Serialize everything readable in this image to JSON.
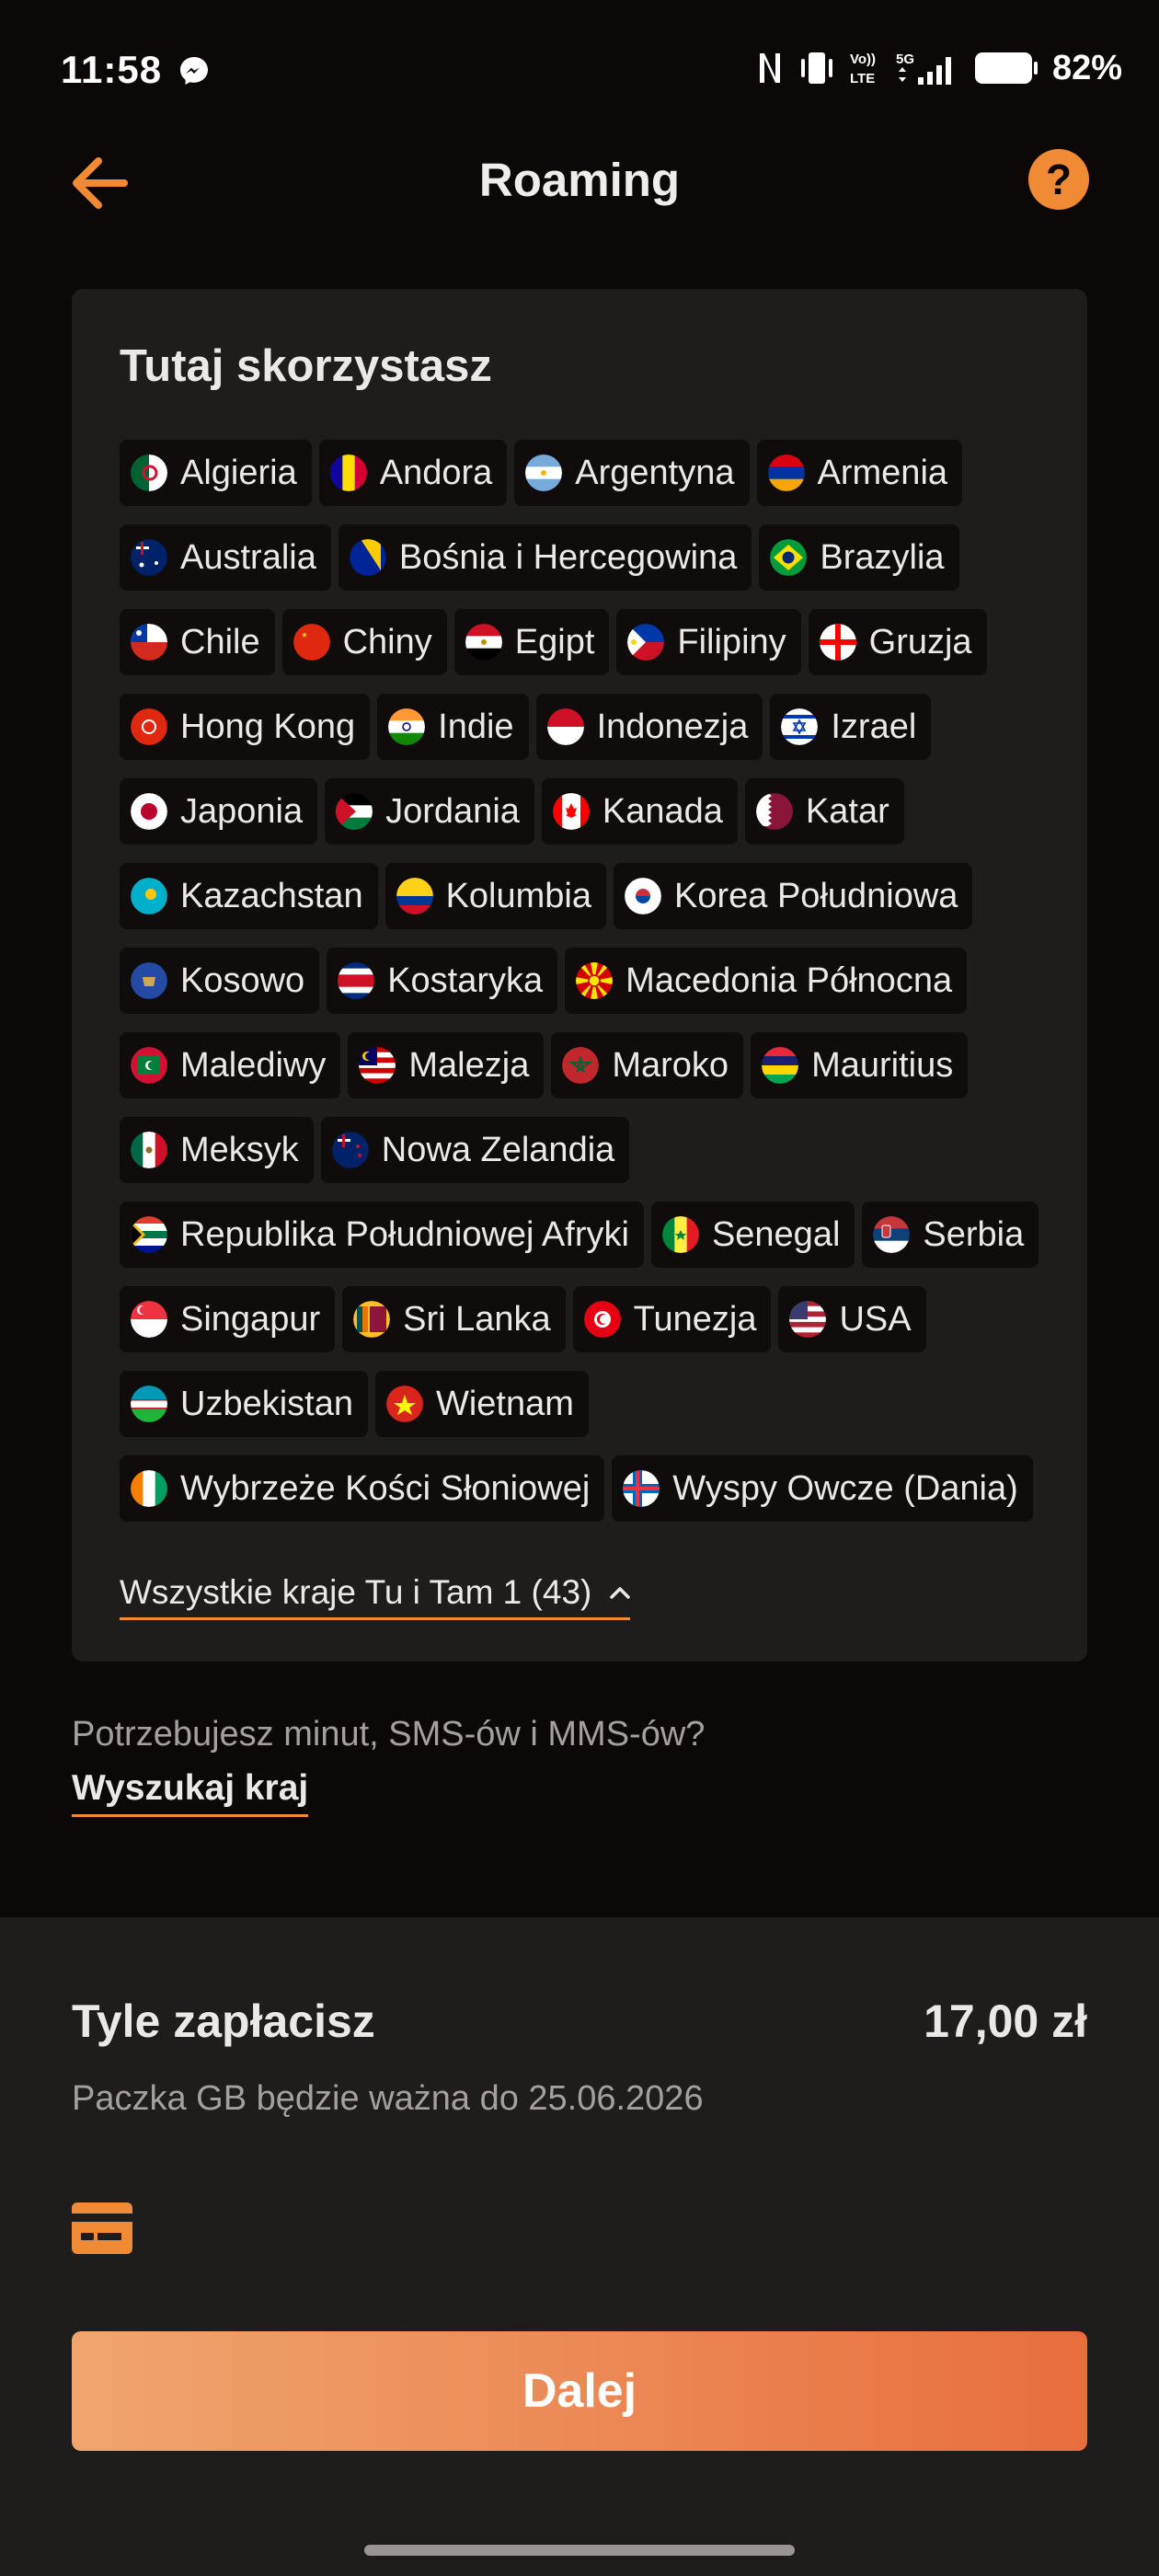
{
  "status_bar": {
    "time": "11:58",
    "network": "5G",
    "lte": "LTE",
    "volte": "Vo))",
    "battery": "82%"
  },
  "header": {
    "title": "Roaming"
  },
  "countries_card": {
    "title": "Tutaj skorzystasz",
    "countries": [
      {
        "name": "Algieria",
        "flag": "algeria"
      },
      {
        "name": "Andora",
        "flag": "andorra"
      },
      {
        "name": "Argentyna",
        "flag": "argentina"
      },
      {
        "name": "Armenia",
        "flag": "armenia"
      },
      {
        "name": "Australia",
        "flag": "australia"
      },
      {
        "name": "Bośnia i Hercegowina",
        "flag": "bosnia"
      },
      {
        "name": "Brazylia",
        "flag": "brazil"
      },
      {
        "name": "Chile",
        "flag": "chile"
      },
      {
        "name": "Chiny",
        "flag": "china"
      },
      {
        "name": "Egipt",
        "flag": "egypt"
      },
      {
        "name": "Filipiny",
        "flag": "philippines"
      },
      {
        "name": "Gruzja",
        "flag": "georgia"
      },
      {
        "name": "Hong Kong",
        "flag": "hongkong"
      },
      {
        "name": "Indie",
        "flag": "india"
      },
      {
        "name": "Indonezja",
        "flag": "indonesia"
      },
      {
        "name": "Izrael",
        "flag": "israel"
      },
      {
        "name": "Japonia",
        "flag": "japan"
      },
      {
        "name": "Jordania",
        "flag": "jordan"
      },
      {
        "name": "Kanada",
        "flag": "canada"
      },
      {
        "name": "Katar",
        "flag": "qatar"
      },
      {
        "name": "Kazachstan",
        "flag": "kazakhstan"
      },
      {
        "name": "Kolumbia",
        "flag": "colombia"
      },
      {
        "name": "Korea Południowa",
        "flag": "southkorea"
      },
      {
        "name": "Kosowo",
        "flag": "kosovo"
      },
      {
        "name": "Kostaryka",
        "flag": "costarica"
      },
      {
        "name": "Macedonia Północna",
        "flag": "macedonia"
      },
      {
        "name": "Malediwy",
        "flag": "maldives"
      },
      {
        "name": "Malezja",
        "flag": "malaysia"
      },
      {
        "name": "Maroko",
        "flag": "morocco"
      },
      {
        "name": "Mauritius",
        "flag": "mauritius"
      },
      {
        "name": "Meksyk",
        "flag": "mexico"
      },
      {
        "name": "Nowa Zelandia",
        "flag": "newzealand"
      },
      {
        "name": "Republika Południowej Afryki",
        "flag": "southafrica"
      },
      {
        "name": "Senegal",
        "flag": "senegal"
      },
      {
        "name": "Serbia",
        "flag": "serbia"
      },
      {
        "name": "Singapur",
        "flag": "singapore"
      },
      {
        "name": "Sri Lanka",
        "flag": "srilanka"
      },
      {
        "name": "Tunezja",
        "flag": "tunisia"
      },
      {
        "name": "USA",
        "flag": "usa"
      },
      {
        "name": "Uzbekistan",
        "flag": "uzbekistan"
      },
      {
        "name": "Wietnam",
        "flag": "vietnam"
      },
      {
        "name": "Wybrzeże Kości Słoniowej",
        "flag": "ivorycoast"
      },
      {
        "name": "Wyspy Owcze (Dania)",
        "flag": "faroe"
      }
    ],
    "all_link": "Wszystkie kraje Tu i Tam 1 (43)"
  },
  "search": {
    "question": "Potrzebujesz minut, SMS-ów i MMS-ów?",
    "link": "Wyszukaj kraj"
  },
  "summary": {
    "label": "Tyle zapłacisz",
    "price": "17,00 zł",
    "validity": "Paczka GB będzie ważna do 25.06.2026",
    "payment_icon": "credit-card-icon",
    "next_button": "Dalej"
  },
  "colors": {
    "accent": "#f08a35",
    "background": "#0c0807",
    "card": "#1f1d1c",
    "chip": "#0f0c0b"
  }
}
